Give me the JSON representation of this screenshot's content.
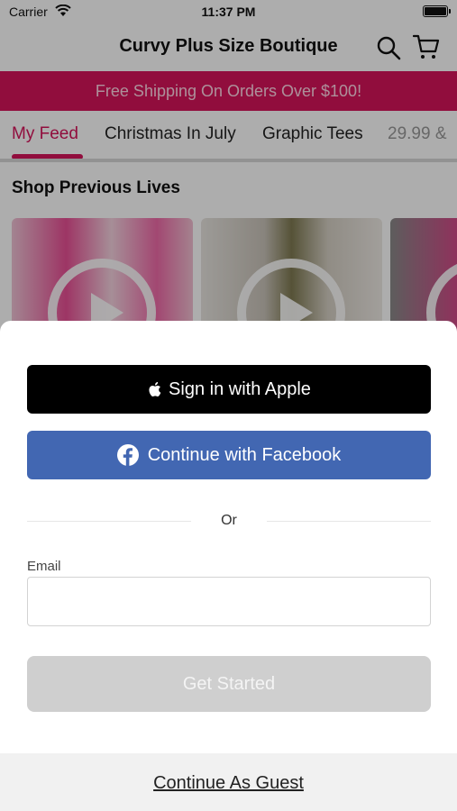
{
  "status_bar": {
    "carrier": "Carrier",
    "time": "11:37 PM"
  },
  "nav": {
    "title": "Curvy Plus Size Boutique"
  },
  "promo": {
    "text": "Free Shipping On Orders Over $100!",
    "bg_color": "#d6145a"
  },
  "tabs": [
    {
      "label": "My Feed",
      "active": true
    },
    {
      "label": "Christmas In July"
    },
    {
      "label": "Graphic Tees"
    },
    {
      "label": "29.99 &"
    }
  ],
  "section": {
    "title": "Shop Previous Lives"
  },
  "sheet": {
    "apple_label": "Sign in with Apple",
    "facebook_label": "Continue with Facebook",
    "or_text": "Or",
    "email_label": "Email",
    "email_value": "",
    "get_started_label": "Get Started",
    "guest_label": "Continue As Guest"
  },
  "colors": {
    "accent": "#d6145a",
    "facebook": "#4267b2",
    "apple": "#000000",
    "disabled_button": "#cfcfcf"
  }
}
